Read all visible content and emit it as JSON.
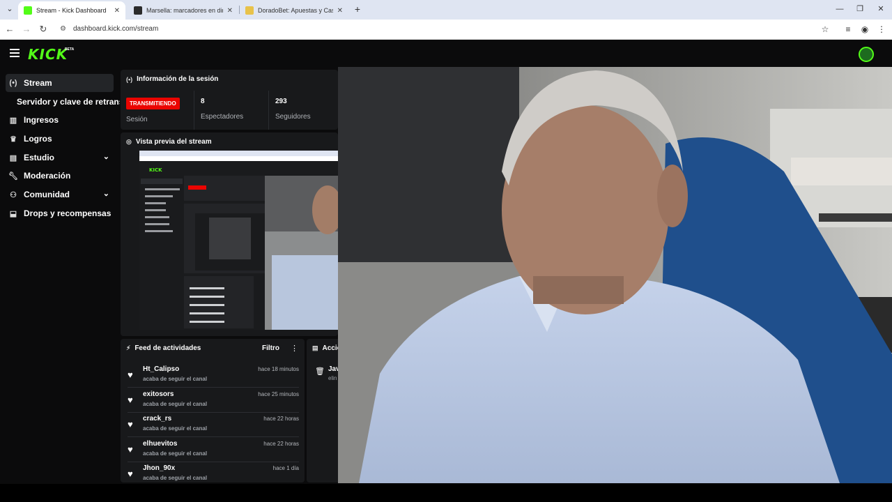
{
  "browser": {
    "tabs": [
      {
        "title": "Stream - Kick Dashboard",
        "active": true,
        "favicon_color": "#53fc18"
      },
      {
        "title": "Marsella: marcadores en directo",
        "active": false,
        "favicon_color": "#2b2b2b"
      },
      {
        "title": "DoradoBet: Apuestas y Casino",
        "active": false,
        "favicon_color": "#e8c24a"
      }
    ],
    "url": "dashboard.kick.com/stream"
  },
  "app": {
    "brand": "KICK",
    "brand_badge": "BETA",
    "accent": "#53fc18",
    "live_color": "#eb0400"
  },
  "sidebar": {
    "items": [
      {
        "label": "Stream",
        "icon": "broadcast-icon",
        "active": true
      },
      {
        "label": "Ingresos",
        "icon": "chart-icon"
      },
      {
        "label": "Logros",
        "icon": "trophy-icon"
      },
      {
        "label": "Estudio",
        "icon": "studio-icon",
        "expandable": true
      },
      {
        "label": "Moderación",
        "icon": "wrench-icon"
      },
      {
        "label": "Comunidad",
        "icon": "community-icon",
        "expandable": true
      },
      {
        "label": "Drops y recompensas",
        "icon": "drops-icon"
      }
    ],
    "subitem": "Servidor y clave de retransmisión"
  },
  "session": {
    "title": "Información de la sesión",
    "status": "TRANSMITIENDO",
    "status_label": "Sesión",
    "viewers": "8",
    "viewers_label": "Espectadores",
    "followers": "293",
    "followers_label": "Seguidores"
  },
  "preview": {
    "title": "Vista previa del stream"
  },
  "feed": {
    "title": "Feed de actividades",
    "filter_label": "Filtro",
    "items": [
      {
        "user": "Ht_Calipso",
        "action": "acaba de seguir el canal",
        "time": "hace 18 minutos"
      },
      {
        "user": "exitosors",
        "action": "acaba de seguir el canal",
        "time": "hace 25 minutos"
      },
      {
        "user": "crack_rs",
        "action": "acaba de seguir el canal",
        "time": "hace 22 horas"
      },
      {
        "user": "elhuevitos",
        "action": "acaba de seguir el canal",
        "time": "hace 22 horas"
      },
      {
        "user": "Jhon_90x",
        "action": "acaba de seguir el canal",
        "time": "hace 1 día"
      }
    ]
  },
  "actions": {
    "title": "Accio",
    "item_title": "Jav",
    "item_sub": "elin"
  }
}
